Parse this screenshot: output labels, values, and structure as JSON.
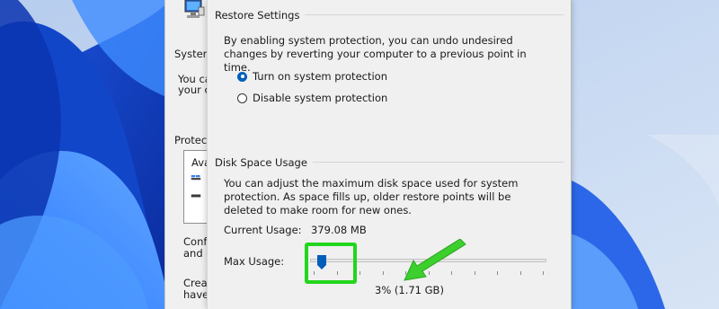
{
  "background_window": {
    "system_label": "System",
    "text_line1": "You ca",
    "text_line2": "your co",
    "protection_label": "Protecti",
    "list_label": "Ava",
    "config_line1": "Config",
    "config_line2": "and d",
    "create_line1": "Creat",
    "create_line2": "have"
  },
  "restore_settings": {
    "title": "Restore Settings",
    "description": "By enabling system protection, you can undo undesired changes by reverting your computer to a previous point in time.",
    "options": [
      {
        "label": "Turn on system protection",
        "checked": true
      },
      {
        "label": "Disable system protection",
        "checked": false
      }
    ]
  },
  "disk_space": {
    "title": "Disk Space Usage",
    "description": "You can adjust the maximum disk space used for system protection. As space fills up, older restore points will be deleted to make room for new ones.",
    "current_usage_label": "Current Usage:",
    "current_usage_value": "379.08 MB",
    "max_usage_label": "Max Usage:",
    "max_usage_readout": "3% (1.71 GB)",
    "max_usage_percent": 3
  },
  "colors": {
    "accent": "#005fb8",
    "highlight": "#22d61c",
    "arrow": "#3ccf2d"
  }
}
